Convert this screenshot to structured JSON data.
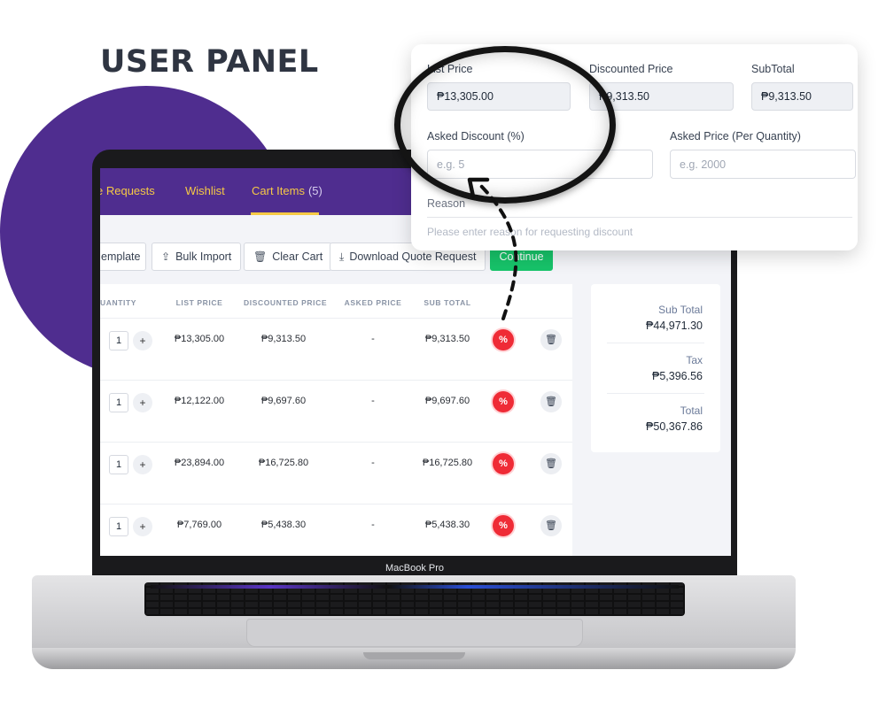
{
  "headline": "USER PANEL",
  "device_label": "MacBook Pro",
  "nav": {
    "items": [
      {
        "label": "e Requests"
      },
      {
        "label": "Wishlist"
      },
      {
        "label": "Cart Items",
        "count": "(5)"
      }
    ]
  },
  "toolbar": {
    "template_label": "emplate",
    "bulk_import_label": "Bulk Import",
    "clear_cart_label": "Clear Cart",
    "download_label": "Download Quote Request",
    "continue_label": "Continue"
  },
  "table": {
    "headers": [
      "UANTITY",
      "LIST PRICE",
      "DISCOUNTED PRICE",
      "ASKED PRICE",
      "SUB TOTAL"
    ],
    "rows": [
      {
        "qty": "1",
        "plus": "+",
        "list_price": "₱13,305.00",
        "discounted_price": "₱9,313.50",
        "asked_price": "-",
        "sub_total": "₱9,313.50",
        "discount_icon": "%"
      },
      {
        "qty": "1",
        "plus": "+",
        "list_price": "₱12,122.00",
        "discounted_price": "₱9,697.60",
        "asked_price": "-",
        "sub_total": "₱9,697.60",
        "discount_icon": "%"
      },
      {
        "qty": "1",
        "plus": "+",
        "list_price": "₱23,894.00",
        "discounted_price": "₱16,725.80",
        "asked_price": "-",
        "sub_total": "₱16,725.80",
        "discount_icon": "%"
      },
      {
        "qty": "1",
        "plus": "+",
        "list_price": "₱7,769.00",
        "discounted_price": "₱5,438.30",
        "asked_price": "-",
        "sub_total": "₱5,438.30",
        "discount_icon": "%"
      }
    ]
  },
  "summary": {
    "sub_total_label": "Sub Total",
    "sub_total_value": "₱44,971.30",
    "tax_label": "Tax",
    "tax_value": "₱5,396.56",
    "total_label": "Total",
    "total_value": "₱50,367.86"
  },
  "popup": {
    "list_price_label": "List Price",
    "list_price_value": "₱13,305.00",
    "discounted_price_label": "Discounted Price",
    "discounted_price_value": "₱9,313.50",
    "subtotal_label": "SubTotal",
    "subtotal_value": "₱9,313.50",
    "asked_discount_label": "Asked Discount (%)",
    "asked_discount_placeholder": "e.g. 5",
    "asked_price_label": "Asked Price (Per Quantity)",
    "asked_price_placeholder": "e.g. 2000",
    "reason_label": "Reason",
    "reason_placeholder": "Please enter reason for requesting discount"
  },
  "colors": {
    "brand_purple": "#4f2d8f",
    "nav_accent": "#f6c945",
    "continue_green": "#17c46a",
    "discount_red": "#ef2b36"
  },
  "icons": {
    "bulk_import": "upload-icon",
    "clear_cart": "trash-icon",
    "download": "download-icon",
    "discount": "percent-badge-icon",
    "delete": "trash-icon"
  }
}
